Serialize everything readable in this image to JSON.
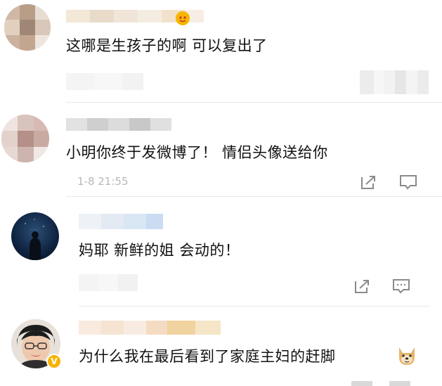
{
  "comments": [
    {
      "text": "这哪是生孩子的啊 可以复出了"
    },
    {
      "text": "小明你终于发微博了！ 情侣头像送给你",
      "time": "1-8 21:55"
    },
    {
      "text": "妈耶 新鲜的姐 会动的！"
    },
    {
      "text": "为什么我在最后看到了家庭主妇的赶脚"
    }
  ],
  "icons": {
    "share": "share-icon",
    "reply": "comment-icon",
    "doge": "doge-emoji-icon",
    "verified": "verified-badge-icon"
  },
  "colors": {
    "text": "#111111",
    "meta": "#b8b8b8",
    "verified": "#f6b300",
    "icon": "#8a8a8a"
  }
}
